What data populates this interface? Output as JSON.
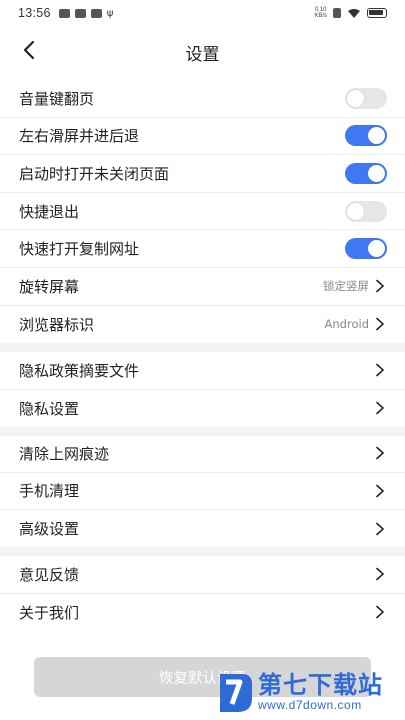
{
  "status_bar": {
    "time": "13:56",
    "network_speed": "0.10\nKB/s"
  },
  "header": {
    "title": "设置"
  },
  "groups": [
    {
      "items": [
        {
          "label": "音量键翻页",
          "type": "toggle",
          "on": false
        },
        {
          "label": "左右滑屏并进后退",
          "type": "toggle",
          "on": true
        },
        {
          "label": "启动时打开未关闭页面",
          "type": "toggle",
          "on": true
        },
        {
          "label": "快捷退出",
          "type": "toggle",
          "on": false
        },
        {
          "label": "快速打开复制网址",
          "type": "toggle",
          "on": true
        },
        {
          "label": "旋转屏幕",
          "type": "link",
          "value": "锁定竖屏"
        },
        {
          "label": "浏览器标识",
          "type": "link",
          "value": "Android"
        }
      ]
    },
    {
      "items": [
        {
          "label": "隐私政策摘要文件",
          "type": "link"
        },
        {
          "label": "隐私设置",
          "type": "link"
        }
      ]
    },
    {
      "items": [
        {
          "label": "清除上网痕迹",
          "type": "link"
        },
        {
          "label": "手机清理",
          "type": "link"
        },
        {
          "label": "高级设置",
          "type": "link"
        }
      ]
    },
    {
      "items": [
        {
          "label": "意见反馈",
          "type": "link"
        },
        {
          "label": "关于我们",
          "type": "link"
        }
      ]
    }
  ],
  "reset_button": {
    "label": "恢复默认设置"
  },
  "watermark": {
    "name": "第七下载站",
    "url": "www.d7down.com"
  },
  "colors": {
    "toggle_on": "#3f78f2",
    "toggle_off": "#e6e6e6",
    "divider": "#f2f3f5"
  }
}
